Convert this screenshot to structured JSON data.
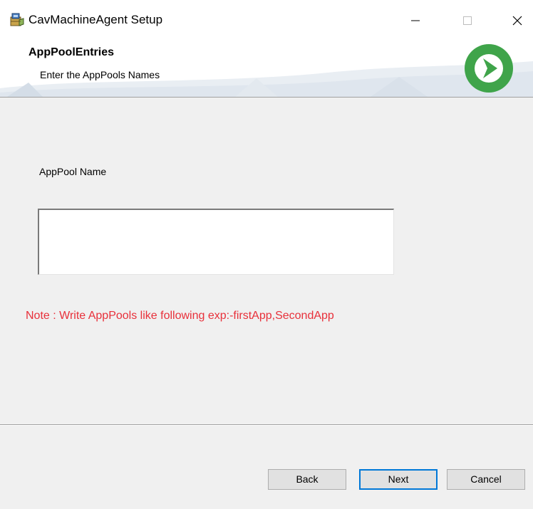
{
  "window": {
    "title": "CavMachineAgent Setup"
  },
  "banner": {
    "heading": "AppPoolEntries",
    "subheading": "Enter the AppPools Names"
  },
  "form": {
    "label": "AppPool Name",
    "input_value": "",
    "note": "Note : Write AppPools like following exp:-firstApp,SecondApp"
  },
  "buttons": {
    "back": "Back",
    "next": "Next",
    "cancel": "Cancel"
  },
  "icons": {
    "app": "installer-package-icon",
    "logo": "cavisson-logo-icon",
    "minimize": "minimize-icon",
    "maximize": "maximize-icon",
    "close": "close-icon"
  },
  "colors": {
    "note_text": "#e8303a",
    "logo_green": "#3fa44a",
    "focus_border": "#0078d7",
    "dialog_bg": "#f0f0f0"
  }
}
